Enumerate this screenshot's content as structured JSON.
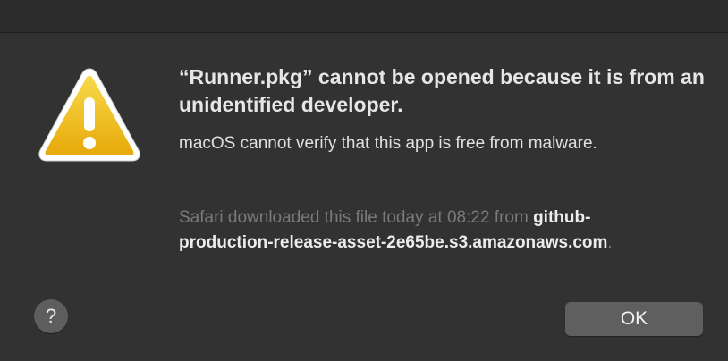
{
  "dialog": {
    "title": "“Runner.pkg” cannot be opened because it is from an unidentified developer.",
    "message": "macOS cannot verify that this app is free from malware.",
    "download_info_prefix": "Safari downloaded this file today at 08:22 from",
    "download_host": "github-production-release-asset-2e65be.s3.amazonaws.com",
    "download_info_suffix": ".",
    "icon": "warning-triangle-icon"
  },
  "buttons": {
    "help_label": "?",
    "ok_label": "OK"
  },
  "colors": {
    "background": "#323232",
    "title_text": "#e6e6e6",
    "muted_text": "#7a7a7a",
    "warning_yellow": "#f3c41c",
    "button_gray": "#5f5f5f"
  }
}
